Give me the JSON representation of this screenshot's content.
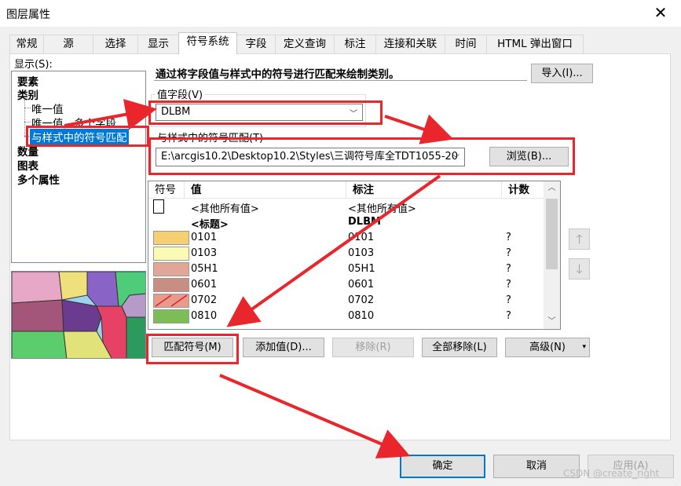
{
  "window": {
    "title": "图层属性",
    "close_glyph": "✕"
  },
  "tabs": [
    "常规",
    "源",
    "选择",
    "显示",
    "符号系统",
    "字段",
    "定义查询",
    "标注",
    "连接和关联",
    "时间",
    "HTML 弹出窗口"
  ],
  "active_tab": "符号系统",
  "show_label": "显示(S):",
  "tree": {
    "items": [
      "要素",
      "类别",
      "唯一值",
      "唯一值，多个字段",
      "与样式中的符号匹配",
      "数量",
      "图表",
      "多个属性"
    ],
    "selected": "与样式中的符号匹配"
  },
  "description": "通过将字段值与样式中的符号进行匹配来绘制类别。",
  "import_button": "导入(I)...",
  "value_field": {
    "label": "值字段(V)",
    "value": "DLBM"
  },
  "style_match": {
    "label": "与样式中的符号匹配(T)",
    "value": "E:\\arcgis10.2\\Desktop10.2\\Styles\\三调符号库全TDT1055-20",
    "browse_button": "浏览(B)..."
  },
  "table": {
    "headers": [
      "符号",
      "值",
      "标注",
      "计数"
    ],
    "rows": [
      {
        "color": "#ffffff",
        "value": "<其他所有值>",
        "label": "<其他所有值>",
        "count": "",
        "bold": false
      },
      {
        "color": "",
        "value": "<标题>",
        "label": "DLBM",
        "count": "",
        "bold": true
      },
      {
        "color": "#f6cf72",
        "value": "0101",
        "label": "0101",
        "count": "?",
        "bold": false
      },
      {
        "color": "#fafab4",
        "value": "0103",
        "label": "0103",
        "count": "?",
        "bold": false
      },
      {
        "color": "#e0a696",
        "value": "05H1",
        "label": "05H1",
        "count": "?",
        "bold": false
      },
      {
        "color": "#c88e82",
        "value": "0601",
        "label": "0601",
        "count": "?",
        "bold": false
      },
      {
        "color": "#e89a8c",
        "value": "0702",
        "label": "0702",
        "count": "?",
        "bold": false
      },
      {
        "color": "#7cbd55",
        "value": "0810",
        "label": "0810",
        "count": "?",
        "bold": false
      }
    ]
  },
  "buttons": {
    "match": "匹配符号(M)",
    "add": "添加值(D)...",
    "remove": "移除(R)",
    "remove_all": "全部移除(L)",
    "advanced": "高级(N)",
    "ok": "确定",
    "cancel": "取消",
    "apply": "应用(A)"
  },
  "icons": {
    "up": "arrow-up-icon",
    "down": "arrow-down-icon"
  },
  "colors": {
    "annotation_red": "#e8262c",
    "selection_blue": "#0078d7"
  },
  "watermark": "CSDN @create_right"
}
